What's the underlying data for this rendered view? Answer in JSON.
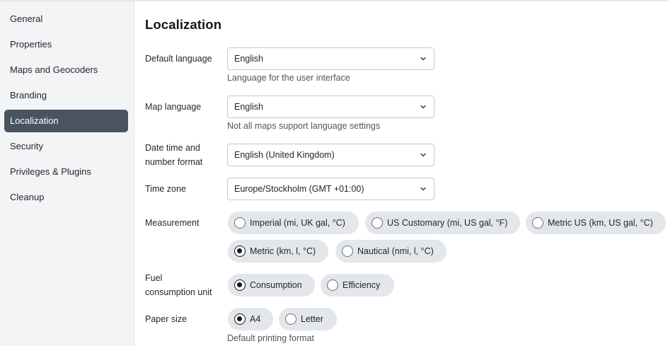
{
  "sidebar": {
    "items": [
      {
        "label": "General"
      },
      {
        "label": "Properties"
      },
      {
        "label": "Maps and Geocoders"
      },
      {
        "label": "Branding"
      },
      {
        "label": "Localization",
        "active": true
      },
      {
        "label": "Security"
      },
      {
        "label": "Privileges & Plugins"
      },
      {
        "label": "Cleanup"
      }
    ]
  },
  "main": {
    "title": "Localization",
    "default_language": {
      "label": "Default language",
      "value": "English",
      "help": "Language for the user interface"
    },
    "map_language": {
      "label": "Map language",
      "value": "English",
      "help": "Not all maps support language settings"
    },
    "date_format": {
      "label_line1": "Date time and",
      "label_line2": "number format",
      "value": "English (United Kingdom)"
    },
    "time_zone": {
      "label": "Time zone",
      "value": "Europe/Stockholm (GMT +01:00)"
    },
    "measurement": {
      "label": "Measurement",
      "options": [
        {
          "label": "Imperial (mi, UK gal, °C)",
          "checked": false
        },
        {
          "label": "US Customary (mi, US gal, °F)",
          "checked": false
        },
        {
          "label": "Metric US (km, US gal, °C)",
          "checked": false
        },
        {
          "label": "Metric (km, l, °C)",
          "checked": true
        },
        {
          "label": "Nautical (nmi, l, °C)",
          "checked": false
        }
      ]
    },
    "fuel": {
      "label_line1": "Fuel",
      "label_line2": "consumption unit",
      "options": [
        {
          "label": "Consumption",
          "checked": true
        },
        {
          "label": "Efficiency",
          "checked": false
        }
      ]
    },
    "paper": {
      "label": "Paper size",
      "options": [
        {
          "label": "A4",
          "checked": true
        },
        {
          "label": "Letter",
          "checked": false
        }
      ],
      "help": "Default printing format"
    }
  },
  "colors": {
    "active_nav_bg": "#4a5360",
    "sidebar_bg": "#f3f4f6",
    "pill_bg": "#e3e6ea"
  },
  "icons": {
    "select_arrow": "chevron-down-icon",
    "radio": "radio-icon"
  }
}
